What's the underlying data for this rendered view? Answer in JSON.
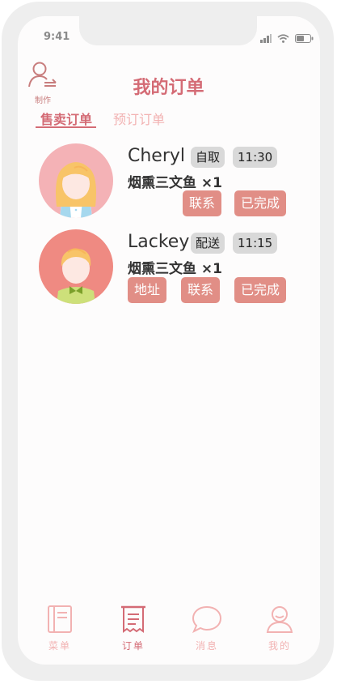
{
  "status_bar": {
    "time": "9:41"
  },
  "header": {
    "make_label": "制作",
    "title": "我的订单"
  },
  "tabs": [
    {
      "label": "售卖订单",
      "active": true
    },
    {
      "label": "预订订单",
      "active": false
    }
  ],
  "orders": [
    {
      "name": "Cheryl",
      "delivery": "自取",
      "time": "11:30",
      "dish": "烟熏三文鱼 ×1",
      "buttons": [
        "联系",
        "已完成"
      ]
    },
    {
      "name": "Lackey",
      "delivery": "配送",
      "time": "11:15",
      "dish": "烟熏三文鱼 ×1",
      "buttons": [
        "地址",
        "联系",
        "已完成"
      ]
    }
  ],
  "bottom_nav": [
    {
      "label": "菜单",
      "icon": "menu-book-icon",
      "active": false
    },
    {
      "label": "订单",
      "icon": "receipt-icon",
      "active": true
    },
    {
      "label": "消息",
      "icon": "chat-bubble-icon",
      "active": false
    },
    {
      "label": "我的",
      "icon": "profile-icon",
      "active": false
    }
  ],
  "colors": {
    "accent": "#d46b75",
    "accent_light": "#f2b2b2",
    "button": "#e18e86",
    "tag_bg": "#d9d9d9"
  }
}
